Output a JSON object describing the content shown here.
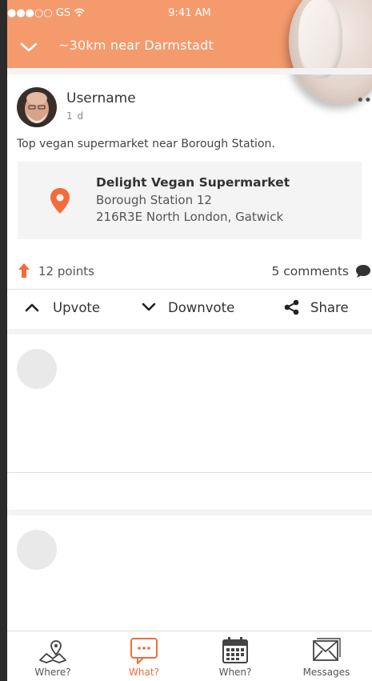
{
  "status_bar": {
    "carrier": "●●●○○ GS",
    "time": "9:41 AM"
  },
  "header": {
    "location_filter": "~30km near Darmstadt"
  },
  "post": {
    "username": "Username",
    "time_ago": "1 d",
    "text": "Top vegan supermarket near Borough Station.",
    "place": {
      "name": "Delight Vegan Supermarket",
      "line1": "Borough Station  12",
      "line2": "216R3E North London, Gatwick"
    },
    "points_count": "12",
    "points_label": "points",
    "comments": "5 comments",
    "actions": {
      "upvote": "Upvote",
      "downvote": "Downvote",
      "share": "Share"
    }
  },
  "tabbar": {
    "tabs": [
      {
        "label": "Where?",
        "icon": "map-pin-icon",
        "active": false
      },
      {
        "label": "What?",
        "icon": "chat-bubble-icon",
        "active": true
      },
      {
        "label": "When?",
        "icon": "calendar-icon",
        "active": false
      },
      {
        "label": "Messages",
        "icon": "envelope-icon",
        "active": false
      }
    ]
  },
  "colors": {
    "brand": "#f59a6d",
    "accent": "#f36c3c",
    "background": "#ffffff"
  }
}
